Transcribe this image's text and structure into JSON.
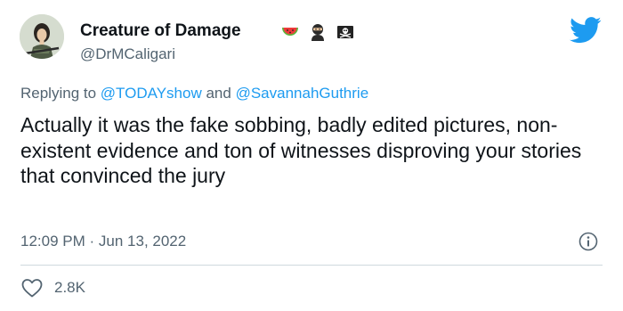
{
  "author": {
    "display_name": "Creature of Damage",
    "handle": "@DrMCaligari",
    "name_emojis": [
      "watermelon-icon",
      "ninja-icon",
      "skull-crossbones-flag-icon"
    ]
  },
  "reply": {
    "prefix": "Replying to",
    "mention_1": "@TODAYshow",
    "joiner": "and",
    "mention_2": "@SavannahGuthrie"
  },
  "tweet": {
    "text": "Actually it was the fake sobbing, badly edited pictures, non-existent evidence and ton of witnesses disproving your stories that convinced the jury"
  },
  "meta": {
    "time": "12:09 PM",
    "separator": "·",
    "date": "Jun 13, 2022"
  },
  "stats": {
    "likes": "2.8K"
  },
  "colors": {
    "brand_blue": "#1d9bf0",
    "secondary_text": "#536471",
    "primary_text": "#0f1419",
    "divider": "#cfd9de"
  }
}
